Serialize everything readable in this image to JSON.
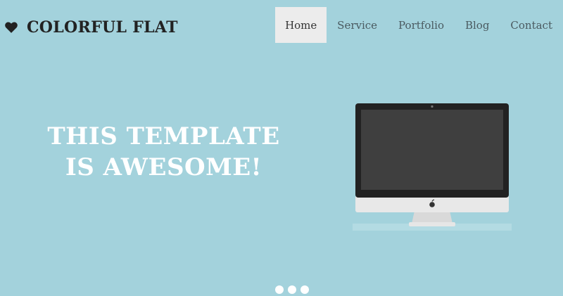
{
  "brand": {
    "icon": "heart-icon",
    "name": "COLORFUL FLAT"
  },
  "nav": {
    "items": [
      {
        "label": "Home",
        "active": true
      },
      {
        "label": "Service",
        "active": false
      },
      {
        "label": "Portfolio",
        "active": false
      },
      {
        "label": "Blog",
        "active": false
      },
      {
        "label": "Contact",
        "active": false
      }
    ]
  },
  "hero": {
    "title_line1": "THIS TEMPLATE",
    "title_line2": "IS AWESOME!",
    "image": "desktop-monitor-illustration"
  },
  "slider": {
    "dot_count": 3
  },
  "colors": {
    "background": "#a3d2dc",
    "nav_active_bg": "#ececec",
    "brand_text": "#222222",
    "hero_text": "#ffffff"
  }
}
